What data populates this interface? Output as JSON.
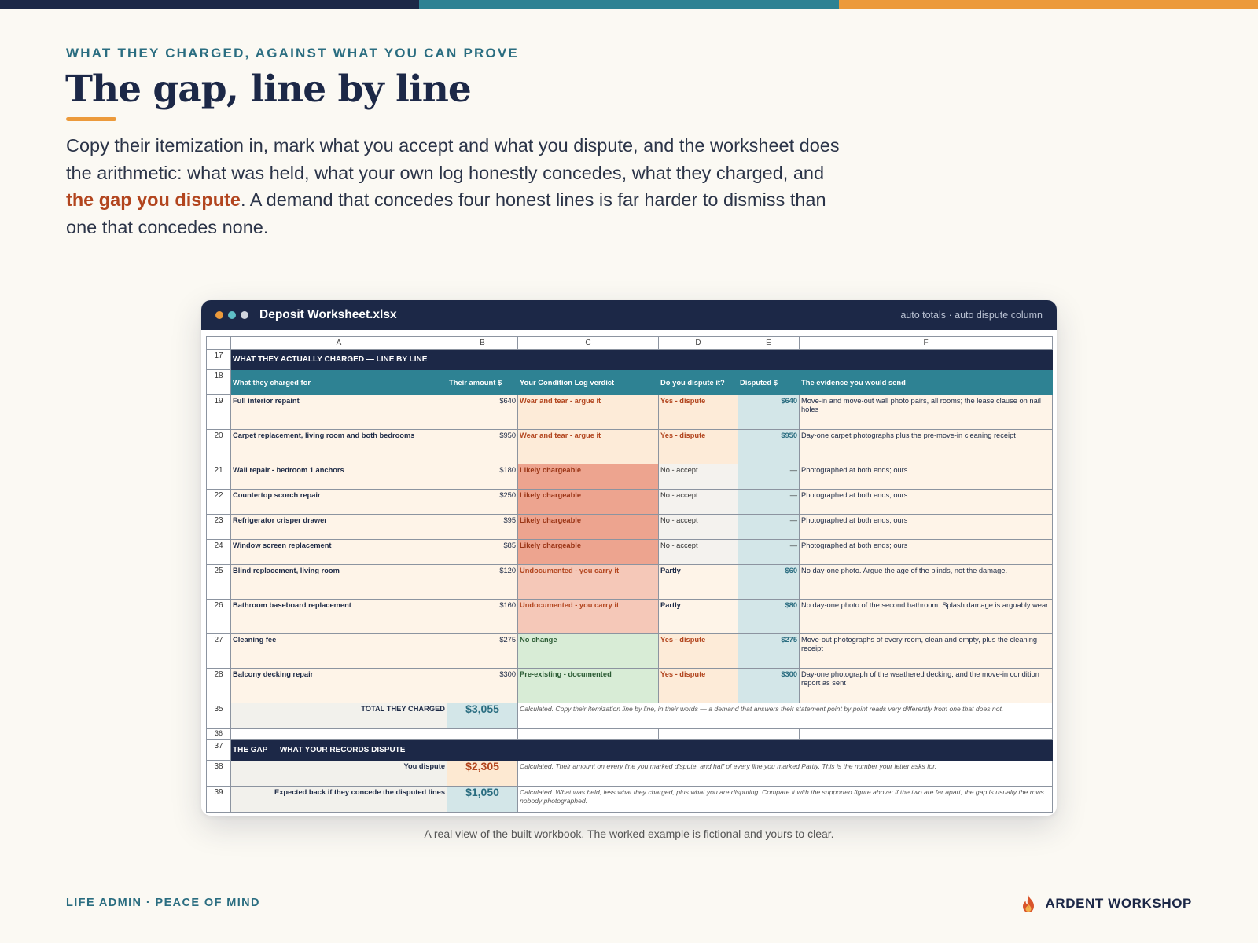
{
  "brand": {
    "colors": {
      "navy": "#1c2847",
      "teal": "#2e8293",
      "orange": "#ec9a3b",
      "rust": "#b2451e"
    }
  },
  "header": {
    "eyebrow": "WHAT THEY CHARGED, AGAINST WHAT YOU CAN PROVE",
    "title": "The gap, line by line",
    "lede_part1": "Copy their itemization in, mark what you accept and what you dispute, and the worksheet does the arithmetic: what was held, what your own log honestly concedes, what they charged, and ",
    "lede_highlight": "the gap you dispute",
    "lede_part2": ". A demand that concedes four honest lines is far harder to dismiss than one that concedes none."
  },
  "window": {
    "file_name": "Deposit Worksheet.xlsx",
    "note": "auto totals · auto dispute column",
    "dot_colors": [
      "#ec9a3b",
      "#5fc0c7",
      "#d0d4dc"
    ]
  },
  "sheet": {
    "columns": [
      "A",
      "B",
      "C",
      "D",
      "E",
      "F"
    ],
    "section1": {
      "row": "17",
      "title": "WHAT THEY ACTUALLY CHARGED — LINE BY LINE"
    },
    "header_row": {
      "row": "18",
      "cells": [
        "What they charged for",
        "Their amount $",
        "Your Condition Log verdict",
        "Do you dispute it?",
        "Disputed $",
        "The evidence you would send"
      ]
    },
    "rows": [
      {
        "row": "19",
        "item": "Full interior repaint",
        "amount": "$640",
        "verdict": "Wear and tear - argue it",
        "dispute": "Yes - dispute",
        "disputed": "$640",
        "evidence": "Move-in and move-out wall photo pairs, all rooms; the lease clause on nail holes"
      },
      {
        "row": "20",
        "item": "Carpet replacement, living room and both bedrooms",
        "amount": "$950",
        "verdict": "Wear and tear - argue it",
        "dispute": "Yes - dispute",
        "disputed": "$950",
        "evidence": "Day-one carpet photographs plus the pre-move-in cleaning receipt"
      },
      {
        "row": "21",
        "item": "Wall repair - bedroom 1 anchors",
        "amount": "$180",
        "verdict": "Likely chargeable",
        "dispute": "No - accept",
        "disputed": "—",
        "evidence": "Photographed at both ends; ours"
      },
      {
        "row": "22",
        "item": "Countertop scorch repair",
        "amount": "$250",
        "verdict": "Likely chargeable",
        "dispute": "No - accept",
        "disputed": "—",
        "evidence": "Photographed at both ends; ours"
      },
      {
        "row": "23",
        "item": "Refrigerator crisper drawer",
        "amount": "$95",
        "verdict": "Likely chargeable",
        "dispute": "No - accept",
        "disputed": "—",
        "evidence": "Photographed at both ends; ours"
      },
      {
        "row": "24",
        "item": "Window screen replacement",
        "amount": "$85",
        "verdict": "Likely chargeable",
        "dispute": "No - accept",
        "disputed": "—",
        "evidence": "Photographed at both ends; ours"
      },
      {
        "row": "25",
        "item": "Blind replacement, living room",
        "amount": "$120",
        "verdict": "Undocumented - you carry it",
        "dispute": "Partly",
        "disputed": "$60",
        "evidence": "No day-one photo. Argue the age of the blinds, not the damage."
      },
      {
        "row": "26",
        "item": "Bathroom baseboard replacement",
        "amount": "$160",
        "verdict": "Undocumented - you carry it",
        "dispute": "Partly",
        "disputed": "$80",
        "evidence": "No day-one photo of the second bathroom. Splash damage is arguably wear."
      },
      {
        "row": "27",
        "item": "Cleaning fee",
        "amount": "$275",
        "verdict": "No change",
        "dispute": "Yes - dispute",
        "disputed": "$275",
        "evidence": "Move-out photographs of every room, clean and empty, plus the cleaning receipt"
      },
      {
        "row": "28",
        "item": "Balcony decking repair",
        "amount": "$300",
        "verdict": "Pre-existing - documented",
        "dispute": "Yes - dispute",
        "disputed": "$300",
        "evidence": "Day-one photograph of the weathered decking, and the move-in condition report as sent"
      }
    ],
    "total": {
      "row": "35",
      "label": "TOTAL THEY CHARGED",
      "value": "$3,055",
      "note": "Calculated. Copy their itemization line by line, in their words — a demand that answers their statement point by point reads very differently from one that does not."
    },
    "blank_row": "36",
    "section2": {
      "row": "37",
      "title": "THE GAP — WHAT YOUR RECORDS DISPUTE"
    },
    "dispute": {
      "row": "38",
      "label": "You dispute",
      "value": "$2,305",
      "note": "Calculated. Their amount on every line you marked dispute, and half of every line you marked Partly. This is the number your letter asks for."
    },
    "expected": {
      "row": "39",
      "label": "Expected back if they concede the disputed lines",
      "value": "$1,050",
      "note": "Calculated. What was held, less what they charged, plus what you are disputing. Compare it with the supported figure above: if the two are far apart, the gap is usually the rows nobody photographed."
    }
  },
  "caption": "A real view of the built workbook. The worked example is fictional and yours to clear.",
  "footer": {
    "left": "LIFE ADMIN · PEACE OF MIND",
    "brand": "ARDENT WORKSHOP",
    "logo_icon": "flame-icon"
  }
}
